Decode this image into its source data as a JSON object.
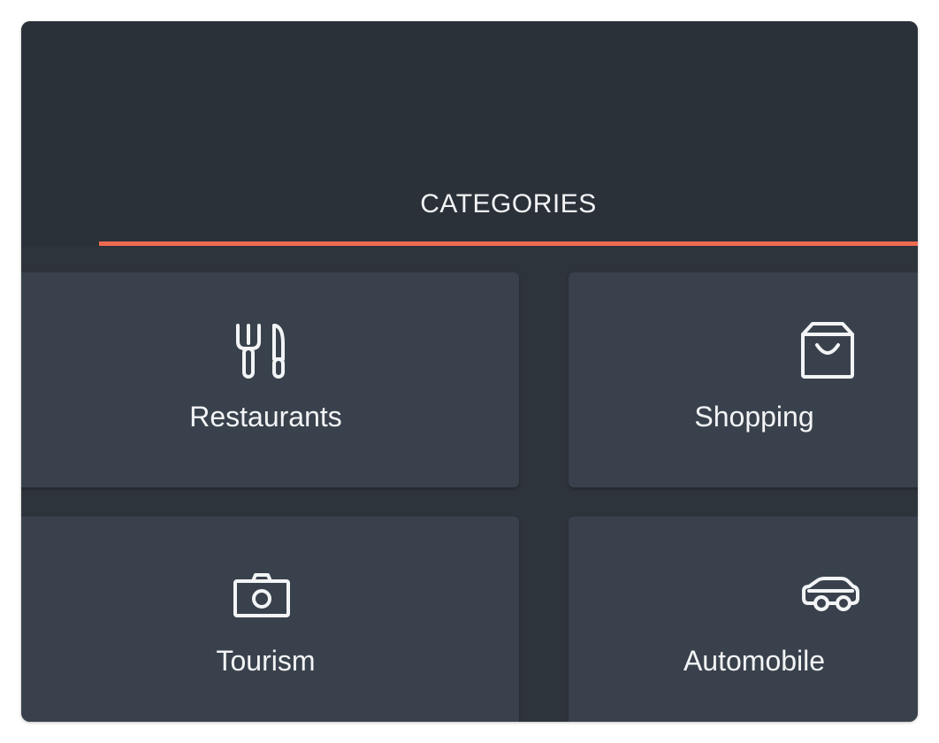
{
  "tabs": [
    {
      "label": "CATEGORIES",
      "active": true
    }
  ],
  "categories": [
    {
      "label": "Restaurants",
      "icon": "fork-knife-icon"
    },
    {
      "label": "Shopping",
      "icon": "shopping-bag-icon"
    },
    {
      "label": "Tourism",
      "icon": "camera-icon"
    },
    {
      "label": "Automobile",
      "icon": "car-icon"
    }
  ],
  "colors": {
    "app_bar": "#2b3139",
    "background": "#2e343b",
    "card": "#39424c",
    "accent": "#ef6a50",
    "text": "#f3f4f6"
  }
}
